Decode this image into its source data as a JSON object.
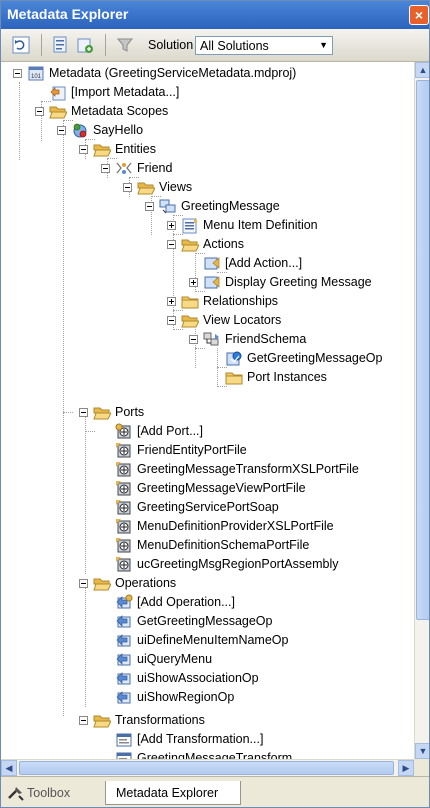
{
  "window": {
    "title": "Metadata Explorer",
    "close_symbol": "×"
  },
  "toolbar": {
    "solution_label": "Solution",
    "solution_value": "All Solutions",
    "dropdown_arrow": "▼"
  },
  "tree": {
    "metadata": "Metadata (GreetingServiceMetadata.mdproj)",
    "import_metadata": "[Import Metadata...]",
    "metadata_scopes": "Metadata Scopes",
    "sayhello": "SayHello",
    "entities": "Entities",
    "friend": "Friend",
    "views": "Views",
    "greeting_message": "GreetingMessage",
    "menu_item_definition": "Menu Item Definition",
    "actions": "Actions",
    "add_action": "[Add Action...]",
    "display_greeting_message": "Display Greeting Message",
    "relationships": "Relationships",
    "view_locators": "View Locators",
    "friend_schema": "FriendSchema",
    "get_greeting_message_op_locator": "GetGreetingMessageOp",
    "port_instances": "Port Instances",
    "ports": "Ports",
    "add_port": "[Add Port...]",
    "port_items": [
      "FriendEntityPortFile",
      "GreetingMessageTransformXSLPortFile",
      "GreetingMessageViewPortFile",
      "GreetingServicePortSoap",
      "MenuDefinitionProviderXSLPortFile",
      "MenuDefinitionSchemaPortFile",
      "ucGreetingMsgRegionPortAssembly"
    ],
    "operations": "Operations",
    "add_operation": "[Add Operation...]",
    "operation_items": [
      "GetGreetingMessageOp",
      "uiDefineMenuItemNameOp",
      "uiQueryMenu",
      "uiShowAssociationOp",
      "uiShowRegionOp"
    ],
    "transformations": "Transformations",
    "add_transformation": "[Add Transformation...]",
    "greeting_message_transform": "GreetingMessageTransform"
  },
  "tabs": {
    "toolbox": "Toolbox",
    "metadata_explorer": "Metadata Explorer"
  },
  "colors": {
    "titlebar": "#3a74cf",
    "close": "#e8602a",
    "folder": "#f3c861",
    "selection": "#316ac5"
  }
}
